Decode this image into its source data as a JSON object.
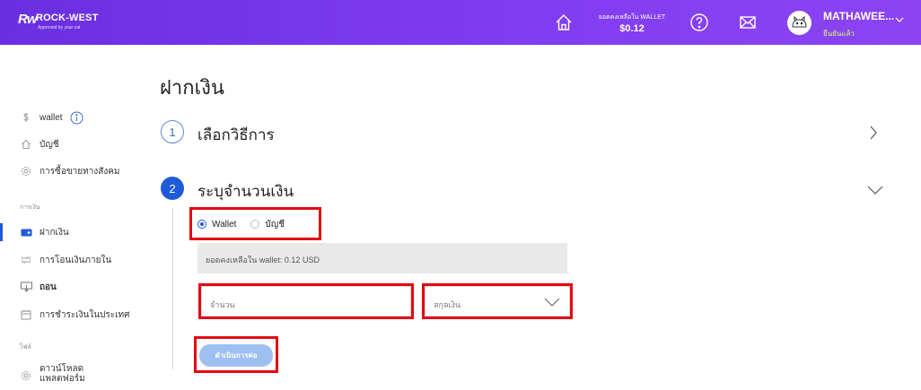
{
  "header": {
    "logo_mark": "Rw",
    "logo_name": "ROCK-WEST",
    "logo_tagline": "Approved by your cat",
    "balance_label": "ยอดคงเหลือใน WALLET",
    "balance_value": "$0.12",
    "username": "MATHAWEE...",
    "user_status": "ยืนยันแล้ว",
    "icons": [
      "home-icon",
      "help-icon",
      "mail-icon",
      "chevron-down-icon"
    ]
  },
  "sidebar": {
    "items": [
      {
        "label": "wallet",
        "icon": "dollar-icon"
      },
      {
        "label": "บัญชี",
        "icon": "home-icon"
      },
      {
        "label": "การซื้อขายทางสังคม",
        "icon": "gear-icon"
      }
    ],
    "section_finance": "การเงิน",
    "finance_items": [
      {
        "label": "ฝากเงิน",
        "icon": "deposit-icon"
      },
      {
        "label": "การโอนเงินภายใน",
        "icon": "transfer-icon"
      },
      {
        "label": "ถอน",
        "icon": "withdraw-icon"
      },
      {
        "label": "การชำระเงินในประเทศ",
        "icon": "calendar-icon"
      }
    ],
    "section_files": "ไฟล์",
    "file_items": [
      {
        "label_line1": "ดาวน์โหลด",
        "label_line2": "แพลตฟอร์ม",
        "icon": "gear-icon"
      }
    ]
  },
  "main": {
    "title": "ฝากเงิน",
    "step1": {
      "number": "1",
      "title": "เลือกวิธีการ"
    },
    "step2": {
      "number": "2",
      "title": "ระบุจำนวนเงิน"
    },
    "radio_wallet": "Wallet",
    "radio_account": "บัญชี",
    "selected_radio": "Wallet",
    "balance_info": "ยอดคงเหลือใน wallet:  0.12 USD",
    "amount_placeholder": "จำนวน",
    "currency_placeholder": "สกุลเงิน",
    "continue_label": "ดำเนินการต่อ"
  },
  "colors": {
    "header_gradient_start": "#6a2fe0",
    "header_gradient_end": "#8c44f2",
    "accent": "#1f5ad8",
    "highlight_box": "#e30613",
    "button": "#9ec0f1"
  }
}
